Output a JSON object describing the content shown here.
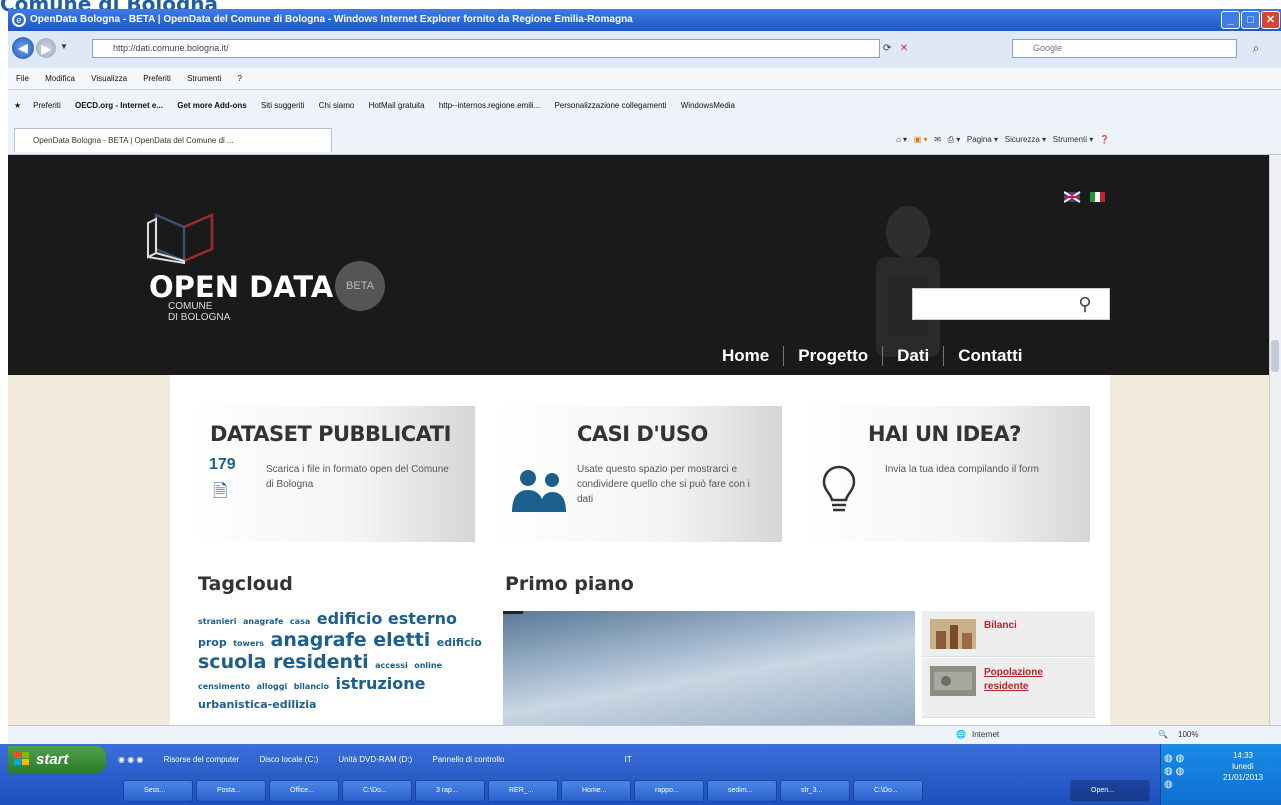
{
  "doc_heading": "Comune di Bologna",
  "window": {
    "title": "OpenData Bologna - BETA | OpenData del Comune di Bologna - Windows Internet Explorer fornito da Regione Emilia-Romagna",
    "minimize": "_",
    "maximize": "□",
    "close": "✕"
  },
  "address_bar": {
    "url": "http://dati.comune.bologna.it/",
    "search_placeholder": "Google",
    "search_button": "⌕"
  },
  "menu": [
    "File",
    "Modifica",
    "Visualizza",
    "Preferiti",
    "Strumenti",
    "?"
  ],
  "favorites_bar": {
    "label": "Preferiti",
    "items": [
      {
        "label": "OECD.org - Internet e...",
        "bold": true
      },
      {
        "label": "Get more Add-ons",
        "bold": true
      },
      {
        "label": "Siti suggeriti",
        "bold": false
      },
      {
        "label": "Chi siamo",
        "bold": false
      },
      {
        "label": "HotMail gratuita",
        "bold": false
      },
      {
        "label": "http--internos.regione.emili...",
        "bold": false
      },
      {
        "label": "Personalizzazione collegamenti",
        "bold": false
      },
      {
        "label": "WindowsMedia",
        "bold": false
      }
    ]
  },
  "tab": {
    "label": "OpenData Bologna - BETA | OpenData del Comune di ..."
  },
  "command_bar": {
    "page": "Pagina",
    "security": "Sicurezza",
    "tools": "Strumenti"
  },
  "site": {
    "title": "OPEN DATA",
    "beta": "BETA",
    "comune_line1": "COMUNE",
    "comune_line2": "DI BOLOGNA",
    "search_placeholder": "",
    "nav": [
      "Home",
      "Progetto",
      "Dati",
      "Contatti"
    ]
  },
  "cards": [
    {
      "title": "DATASET PUBBLICATI",
      "count": "179",
      "description": "Scarica i file in formato open del Comune di Bologna"
    },
    {
      "title": "CASI D'USO",
      "description": "Usate questo spazio per mostrarci e condividere quello che si può fare con i dati"
    },
    {
      "title": "HAI UN IDEA?",
      "description": "Invia la tua idea compilando il form"
    }
  ],
  "tagcloud": {
    "title": "Tagcloud",
    "tags": [
      {
        "text": "stranieri",
        "size": 1
      },
      {
        "text": "anagrafe",
        "size": 1
      },
      {
        "text": "casa",
        "size": 1
      },
      {
        "text": "edificio esterno",
        "size": 3
      },
      {
        "text": "prop",
        "size": 2
      },
      {
        "text": "towers",
        "size": 1
      },
      {
        "text": "anagrafe eletti",
        "size": 4
      },
      {
        "text": "edificio",
        "size": 2
      },
      {
        "text": "scuola",
        "size": 4
      },
      {
        "text": "residenti",
        "size": 4
      },
      {
        "text": "accessi",
        "size": 1
      },
      {
        "text": "online",
        "size": 1
      },
      {
        "text": "censimento",
        "size": 1
      },
      {
        "text": "alloggi",
        "size": 1
      },
      {
        "text": "bilancio",
        "size": 1
      },
      {
        "text": "istruzione",
        "size": 3
      },
      {
        "text": "urbanistica-edilizia",
        "size": 2
      }
    ]
  },
  "primo_piano": {
    "title": "Primo piano",
    "items": [
      {
        "label": "Bilanci"
      },
      {
        "label": "Popolazione residente"
      }
    ]
  },
  "status_bar": {
    "zone": "Internet",
    "zoom": "100%"
  },
  "taskbar": {
    "start": "start",
    "quicklaunch": [
      "Risorse del computer",
      "Disco locale (C:)",
      "Unità DVD-RAM (D:)",
      "Pannello di controllo"
    ],
    "language": "IT",
    "buttons": [
      "Sess...",
      "Posta...",
      "Office...",
      "C:\\Do...",
      "3 rap...",
      "RER_...",
      "Home...",
      "rappo...",
      "sedim...",
      "str_3...",
      "C:\\Do...",
      "Open..."
    ],
    "time": "14:33",
    "day": "lunedì",
    "date": "21/01/2013"
  },
  "colors": {
    "header_bg": "#1a1a1a",
    "accent_blue": "#1c5f8e",
    "link_red": "#b5262b",
    "page_bg": "#f2ebdc"
  }
}
